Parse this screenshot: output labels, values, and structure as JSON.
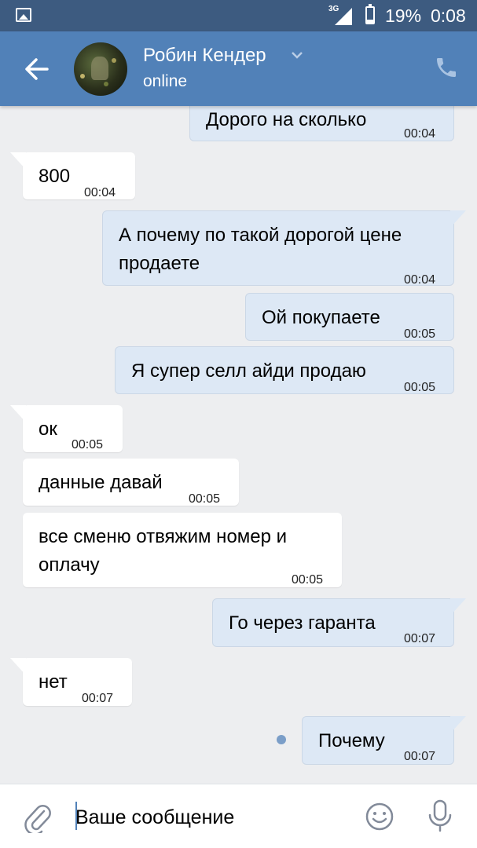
{
  "status_bar": {
    "network": "3G",
    "battery": "19%",
    "time": "0:08"
  },
  "header": {
    "name": "Робин Кендер",
    "status": "online"
  },
  "messages": [
    {
      "text": "Дорого на сколько",
      "time": "00:04"
    },
    {
      "text": "800",
      "time": "00:04"
    },
    {
      "text": "А почему по такой дорогой цене продаете",
      "time": "00:04"
    },
    {
      "text": "Ой покупаете",
      "time": "00:05"
    },
    {
      "text": "Я супер селл айди продаю",
      "time": "00:05"
    },
    {
      "text": "ок",
      "time": "00:05"
    },
    {
      "text": "данные давай",
      "time": "00:05"
    },
    {
      "text": "все сменю отвяжим номер и оплачу",
      "time": "00:05"
    },
    {
      "text": "Го через гаранта",
      "time": "00:07"
    },
    {
      "text": "нет",
      "time": "00:07"
    },
    {
      "text": "Почему",
      "time": "00:07"
    }
  ],
  "composer": {
    "placeholder": "Ваше сообщение"
  },
  "colors": {
    "header": "#5181b8",
    "status_bar": "#3d5b80",
    "background": "#edeef0",
    "outgoing_bubble": "#dde8f5",
    "incoming_bubble": "#ffffff"
  },
  "icons": {
    "back": "back-arrow-icon",
    "call": "phone-icon",
    "attach": "paperclip-icon",
    "emoji": "smile-icon",
    "voice": "microphone-icon"
  }
}
